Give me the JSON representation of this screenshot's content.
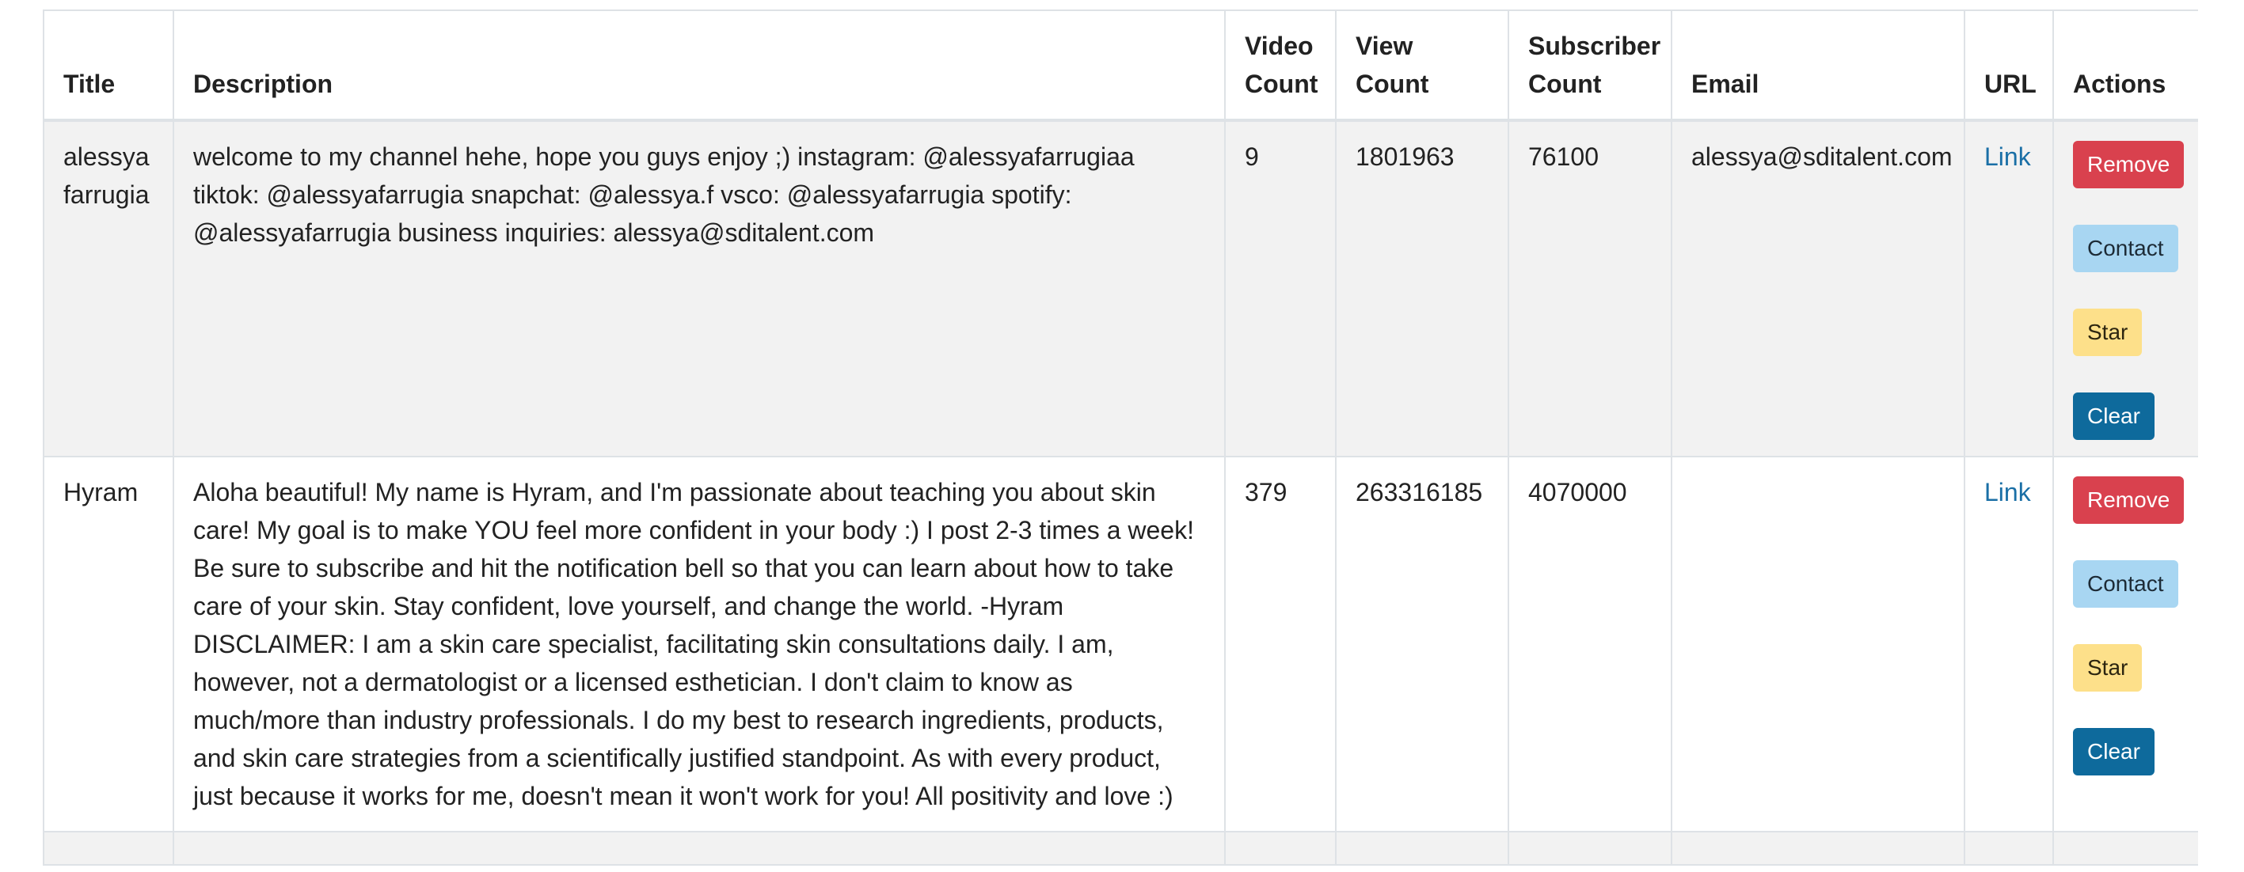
{
  "table": {
    "headers": {
      "title": "Title",
      "description": "Description",
      "video_count": "Video Count",
      "view_count": "View Count",
      "subscriber_count": "Subscriber Count",
      "email": "Email",
      "url": "URL",
      "actions": "Actions"
    },
    "rows": [
      {
        "title": "alessya farrugia",
        "description": "welcome to my channel hehe, hope you guys enjoy ;) instagram: @alessyafarrugiaa tiktok: @alessyafarrugia snapchat: @alessya.f vsco: @alessyafarrugia spotify: @alessyafarrugia business inquiries: alessya@sditalent.com",
        "video_count": "9",
        "view_count": "1801963",
        "subscriber_count": "76100",
        "email": "alessya@sditalent.com",
        "url_label": "Link"
      },
      {
        "title": "Hyram",
        "description": "Aloha beautiful! My name is Hyram, and I'm passionate about teaching you about skin care! My goal is to make YOU feel more confident in your body :) I post 2-3 times a week! Be sure to subscribe and hit the notification bell so that you can learn about how to take care of your skin. Stay confident, love yourself, and change the world. -Hyram DISCLAIMER: I am a skin care specialist, facilitating skin consultations daily. I am, however, not a dermatologist or a licensed esthetician. I don't claim to know as much/more than industry professionals. I do my best to research ingredients, products, and skin care strategies from a scientifically justified standpoint. As with every product, just because it works for me, doesn't mean it won't work for you! All positivity and love :)",
        "video_count": "379",
        "view_count": "263316185",
        "subscriber_count": "4070000",
        "email": "",
        "url_label": "Link"
      }
    ],
    "actions": {
      "remove": "Remove",
      "contact": "Contact",
      "star": "Star",
      "clear": "Clear"
    }
  },
  "colors": {
    "remove": "#d9414e",
    "contact": "#a8d6f2",
    "star": "#fde08a",
    "clear": "#0e6a9c",
    "link": "#1a6fa6",
    "stripe": "#f2f2f2",
    "border": "#dee2e6"
  }
}
